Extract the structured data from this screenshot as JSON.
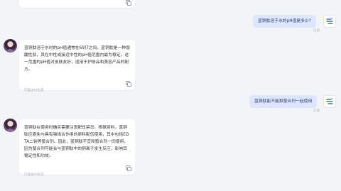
{
  "conversation": {
    "top_card": {
      "copy_icon": "copy-icon"
    },
    "messages": [
      {
        "role": "user",
        "text": "蓝铜肽溶于水的pH值是多少?",
        "status": "已读"
      },
      {
        "role": "assistant",
        "text": "蓝铜肽溶于水时的pH值通常在6到7之间。蓝铜肽是一种弱酸性肽，其在中性或接近中性的pH值范围内最为稳定。这一范围的pH值对皮肤友好，适用于护肤品和美容产品的配方。",
        "note": "内容由AI生成"
      },
      {
        "role": "user",
        "text": "蓝铜肽能不能和螯合剂一起使用",
        "status": "已读"
      },
      {
        "role": "assistant",
        "text": "蓝铜肽在使用时确实需要注意配伍禁忌。根据资料，蓝铜肽应避免与具有强络合作用的原料配伍使用，其中包括EDTA二钠等螯合剂。因此，蓝铜肽不宜和螯合剂一同使用，因为螯合剂可能会与蓝铜肽中的铜离子发生反应，影响其稳定性和功效。",
        "note": "内容由AI生成"
      }
    ]
  },
  "icons": {
    "assistant_avatar": "assistant-avatar",
    "user_avatar": "user-logo-icon",
    "copy": "copy-icon"
  },
  "colors": {
    "user_bubble": "#dde6fd",
    "background": "#f3f4f7"
  }
}
